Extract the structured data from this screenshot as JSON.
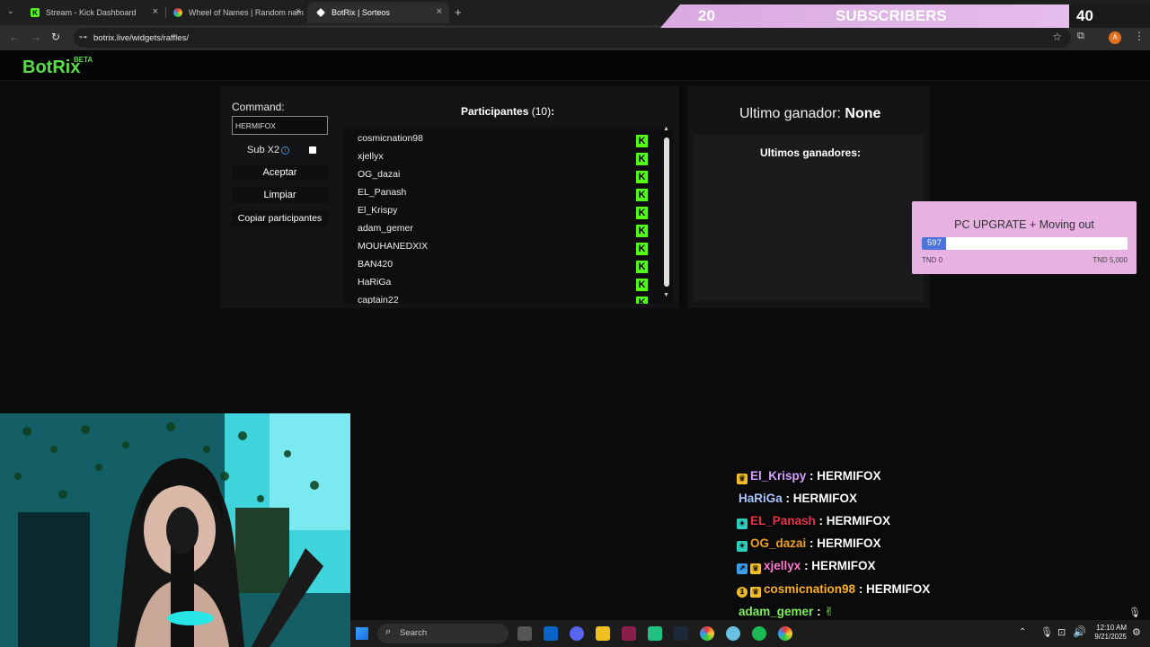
{
  "browser": {
    "tabs": [
      {
        "title": "Stream - Kick Dashboard",
        "active": false
      },
      {
        "title": "Wheel of Names | Random nam",
        "active": false
      },
      {
        "title": "BotRix | Sorteos",
        "active": true
      }
    ],
    "new_tab": "+",
    "url": "botrix.live/widgets/raffles/"
  },
  "overlay": {
    "sub_current": "20",
    "sub_label": "SUBSCRIBERS",
    "sub_goal": "40"
  },
  "site": {
    "logo": "BotRix",
    "beta": "BETA"
  },
  "raffle": {
    "command_label": "Command:",
    "command_value": "HERMIFOX",
    "sub_label": "Sub X2",
    "accept_button": "Aceptar",
    "clear_button": "Limpiar",
    "copy_button": "Copiar participantes",
    "participants_title": "Participantes",
    "participants_count": "(10)",
    "participants_colon": ":",
    "participants": [
      "cosmicnation98",
      "xjellyx",
      "OG_dazai",
      "EL_Panash",
      "El_Krispy",
      "adam_gemer",
      "MOUHANEDXIX",
      "BAN420",
      "HaRiGa",
      "captain22"
    ]
  },
  "winners": {
    "last_label": "Ultimo ganador:",
    "last_value": "None",
    "list_title": "Ultimos ganadores:"
  },
  "goal": {
    "title": "PC UPGRATE + Moving out",
    "amount": "597",
    "min": "TND 0",
    "max": "TND 5,000",
    "progress": 0.1194,
    "color": "#4e73d9"
  },
  "chat": [
    {
      "user": "El_Krispy",
      "msg": ": HERMIFOX",
      "color": "#d7a2ff"
    },
    {
      "user": "HaRiGa",
      "msg": ": HERMIFOX",
      "color": "#a8c8ff"
    },
    {
      "user": "EL_Panash",
      "msg": ": HERMIFOX",
      "color": "#e8304a"
    },
    {
      "user": "OG_dazai",
      "msg": ": HERMIFOX",
      "color": "#f0a020"
    },
    {
      "user": "xjellyx",
      "msg": ": HERMIFOX",
      "color": "#ff7ad0"
    },
    {
      "user": "cosmicnation98",
      "msg": ": HERMIFOX",
      "color": "#ffb020"
    },
    {
      "user": "adam_gemer",
      "msg": ":",
      "color": "#7ff05a"
    }
  ],
  "taskbar": {
    "search_placeholder": "Search",
    "time": "12:10 AM",
    "date": "9/21/2025",
    "avatar_letter": "A"
  }
}
